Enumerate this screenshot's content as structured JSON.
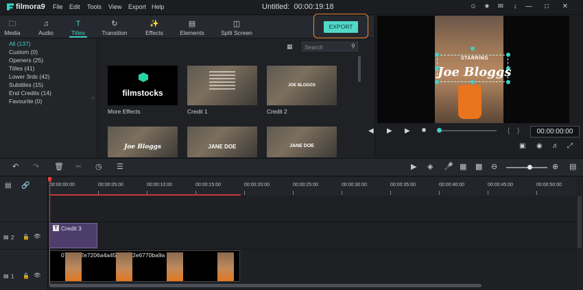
{
  "app": {
    "name": "filmora9",
    "menu": [
      "File",
      "Edit",
      "Tools",
      "View",
      "Export",
      "Help"
    ],
    "title": "Untitled:",
    "title_timecode": "00:00:19:18"
  },
  "tabs": [
    {
      "label": "Media",
      "icon": "folder-icon"
    },
    {
      "label": "Audio",
      "icon": "music-note-icon"
    },
    {
      "label": "Titles",
      "icon": "titles-icon",
      "active": true
    },
    {
      "label": "Transition",
      "icon": "transition-icon"
    },
    {
      "label": "Effects",
      "icon": "effects-icon"
    },
    {
      "label": "Elements",
      "icon": "image-icon"
    },
    {
      "label": "Split Screen",
      "icon": "split-screen-icon"
    }
  ],
  "export_label": "EXPORT",
  "categories": [
    "All (137)",
    "Custom (0)",
    "Openers (25)",
    "Titles (41)",
    "Lower 3rds (42)",
    "Subtitles (15)",
    "End Credits (14)",
    "Favourite (0)"
  ],
  "search": {
    "placeholder": "Search"
  },
  "thumbnails": {
    "row1": [
      {
        "label": "More Effects",
        "brand": "filmstocks"
      },
      {
        "label": "Credit 1"
      },
      {
        "label": "Credit 2",
        "overlay": "JOE BLOGGS"
      }
    ],
    "row2_overlays": [
      "Joe Bloggs",
      "JANE DOE",
      "JANE DOE"
    ]
  },
  "preview": {
    "overlay_small": "STARRING",
    "overlay_title": "Joe Bloggs",
    "timecode": "00:00:00:00",
    "progress": 0.0
  },
  "timeline": {
    "ruler": [
      "00:00:00:00",
      "00:00:05:00",
      "00:00:10:00",
      "00:00:15:00",
      "00:00:20:00",
      "00:00:25:00",
      "00:00:30:00",
      "00:00:35:00",
      "00:00:40:00",
      "00:00:45:00",
      "00:00:50:00"
    ],
    "tracks": [
      {
        "number": "2",
        "clip": "Credit 3"
      },
      {
        "number": "1",
        "clip": "07e9622e7206a4a45927182e6770ba9a"
      }
    ],
    "zoom": 0.6
  },
  "colors": {
    "accent": "#3fd1c5",
    "export_btn": "#53d8c8",
    "highlight": "#f08a2f",
    "playhead": "#e63d3d",
    "title_clip": "#4c3d6b"
  }
}
